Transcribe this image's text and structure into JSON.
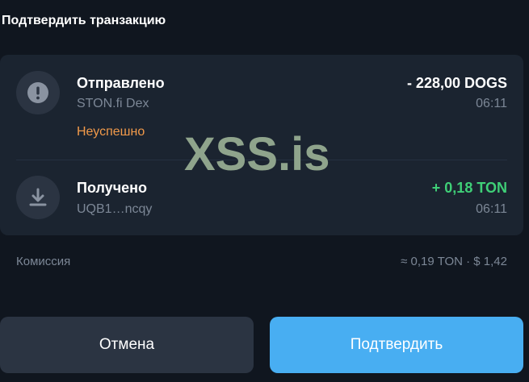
{
  "header": {
    "title": "Подтвердить транзакцию"
  },
  "transactions": [
    {
      "icon": "exclamation-icon",
      "name": "Отправлено",
      "sub": "STON.fi Dex",
      "status": "Неуспешно",
      "amount": "- 228,00 DOGS",
      "time": "06:11"
    },
    {
      "icon": "arrow-down-icon",
      "name": "Получено",
      "sub": "UQB1…ncqy",
      "amount": "+ 0,18 TON",
      "time": "06:11"
    }
  ],
  "watermark": "XSS.is",
  "fee": {
    "label": "Комиссия",
    "value": "≈ 0,19 TON · $ 1,42"
  },
  "buttons": {
    "cancel": "Отмена",
    "confirm": "Подтвердить"
  },
  "colors": {
    "background": "#10161f",
    "card": "#1b2430",
    "accent": "#48aef2",
    "positive": "#3fcf77",
    "warning": "#f29a4a",
    "muted": "#7c8796"
  }
}
